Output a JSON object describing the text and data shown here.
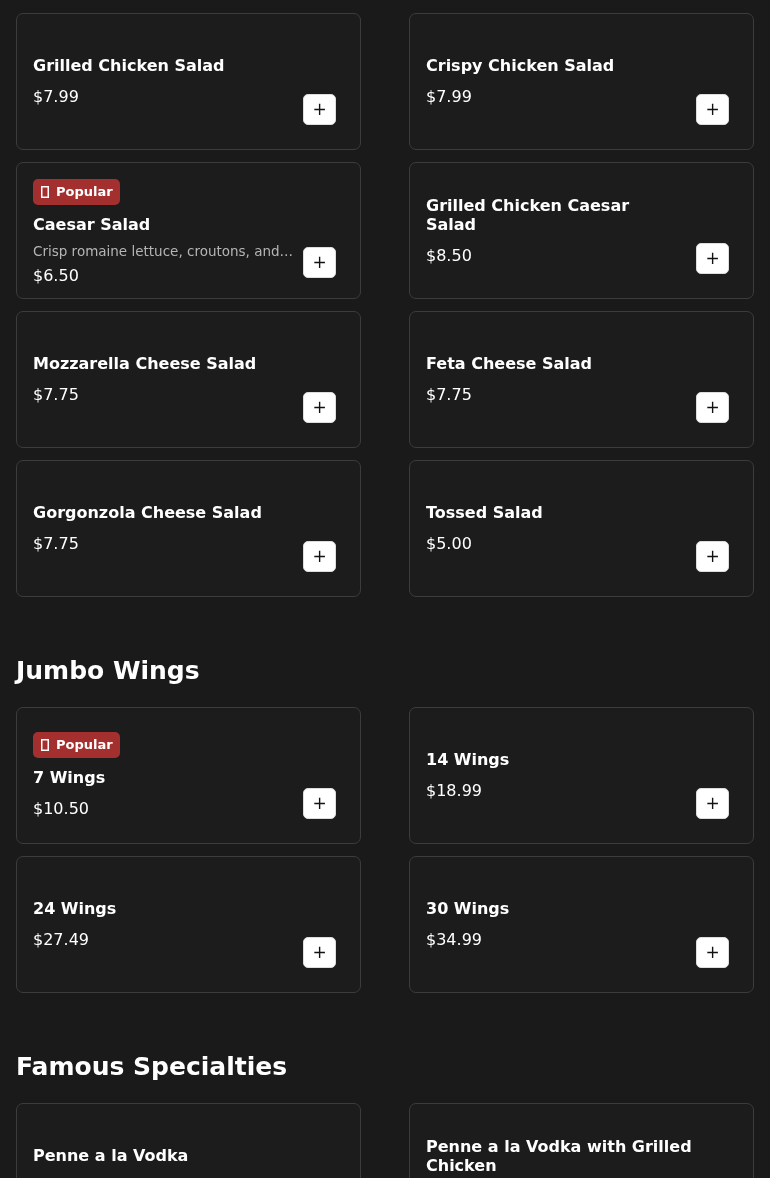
{
  "sections": [
    {
      "items": [
        {
          "name": "Grilled Chicken Salad",
          "price": "$7.99"
        },
        {
          "name": "Crispy Chicken Salad",
          "price": "$7.99"
        },
        {
          "name": "Caesar Salad",
          "price": "$6.50",
          "badge": "Popular",
          "description": "Crisp romaine lettuce, croutons, and…"
        },
        {
          "name": "Grilled Chicken Caesar Salad",
          "price": "$8.50"
        },
        {
          "name": "Mozzarella Cheese Salad",
          "price": "$7.75"
        },
        {
          "name": "Feta Cheese Salad",
          "price": "$7.75"
        },
        {
          "name": "Gorgonzola Cheese Salad",
          "price": "$7.75"
        },
        {
          "name": "Tossed Salad",
          "price": "$5.00"
        }
      ]
    },
    {
      "title": "Jumbo Wings",
      "items": [
        {
          "name": "7 Wings",
          "price": "$10.50",
          "badge": "Popular"
        },
        {
          "name": "14 Wings",
          "price": "$18.99"
        },
        {
          "name": "24 Wings",
          "price": "$27.49"
        },
        {
          "name": "30 Wings",
          "price": "$34.99"
        }
      ]
    },
    {
      "title": "Famous Specialties",
      "items": [
        {
          "name": "Penne a la Vodka"
        },
        {
          "name": "Penne a la Vodka with Grilled Chicken"
        }
      ]
    }
  ],
  "add_button_label": "+"
}
